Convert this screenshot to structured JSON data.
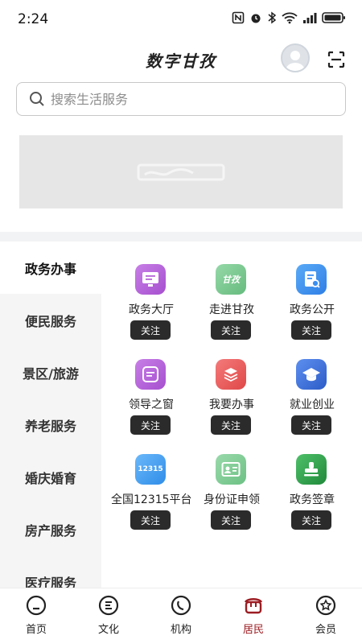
{
  "status": {
    "time": "2:24"
  },
  "header": {
    "title": "数字甘孜"
  },
  "search": {
    "placeholder": "搜索生活服务"
  },
  "sidebar": {
    "items": [
      {
        "label": "政务办事",
        "active": true
      },
      {
        "label": "便民服务",
        "active": false
      },
      {
        "label": "景区/旅游",
        "active": false
      },
      {
        "label": "养老服务",
        "active": false
      },
      {
        "label": "婚庆婚育",
        "active": false
      },
      {
        "label": "房产服务",
        "active": false
      },
      {
        "label": "医疗服务",
        "active": false
      }
    ]
  },
  "services": {
    "follow_label": "关注",
    "items": [
      {
        "label": "政务大厅",
        "icon": "monitor-icon",
        "color": "#b763d8"
      },
      {
        "label": "走进甘孜",
        "icon": "ganzi-logo-icon",
        "color": "#7cc992",
        "badge": "甘孜"
      },
      {
        "label": "政务公开",
        "icon": "document-search-icon",
        "color": "#3b8ff0"
      },
      {
        "label": "领导之窗",
        "icon": "message-window-icon",
        "color": "#b763d8"
      },
      {
        "label": "我要办事",
        "icon": "layers-icon",
        "color": "#ee5c5c"
      },
      {
        "label": "就业创业",
        "icon": "graduation-cap-icon",
        "color": "#3f70d8"
      },
      {
        "label": "全国12315平台",
        "icon": "12315-icon",
        "color": "#3f9df2",
        "badge": "12315"
      },
      {
        "label": "身份证申领",
        "icon": "id-card-icon",
        "color": "#7cc992"
      },
      {
        "label": "政务签章",
        "icon": "stamp-icon",
        "color": "#2fa64a"
      }
    ]
  },
  "tabbar": {
    "items": [
      {
        "label": "首页",
        "icon": "home-icon",
        "active": false
      },
      {
        "label": "文化",
        "icon": "culture-icon",
        "active": false
      },
      {
        "label": "机构",
        "icon": "institution-icon",
        "active": false
      },
      {
        "label": "居民",
        "icon": "residents-icon",
        "active": true
      },
      {
        "label": "会员",
        "icon": "member-icon",
        "active": false
      }
    ],
    "active_color": "#9c1c22"
  }
}
